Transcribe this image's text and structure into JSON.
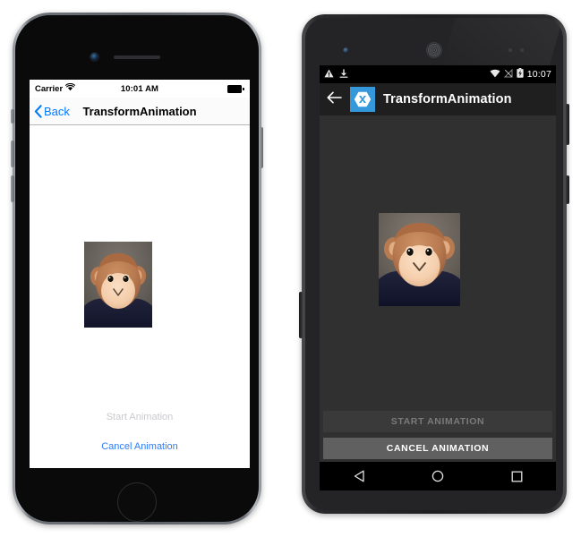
{
  "scene": {
    "description": "Side-by-side iOS and Android simulator screenshots of a TransformAnimation sample app",
    "devices": [
      "iphone",
      "android"
    ]
  },
  "ios": {
    "device_name": "iPhone",
    "status_bar": {
      "carrier": "Carrier",
      "wifi_icon": "wifi-icon",
      "time": "10:01 AM",
      "battery_icon": "battery-full-icon"
    },
    "nav_bar": {
      "back_icon": "chevron-left-icon",
      "back_label": "Back",
      "title": "TransformAnimation"
    },
    "content": {
      "image_name": "monkey-photo"
    },
    "actions": [
      {
        "label": "Start Animation",
        "state": "disabled",
        "color": "#c9c9ce"
      },
      {
        "label": "Cancel Animation",
        "state": "enabled",
        "color": "#2f7bf6"
      }
    ],
    "hardware": {
      "camera": "front-camera",
      "speaker": "earpiece-speaker",
      "home_button": "home-button"
    }
  },
  "android": {
    "device_name": "Android phone",
    "status_bar": {
      "left_icons": [
        "warning-triangle-icon",
        "download-icon"
      ],
      "right_icons": [
        "wifi-icon",
        "no-signal-icon",
        "battery-charging-icon"
      ],
      "time": "10:07"
    },
    "app_bar": {
      "back_icon": "arrow-left-icon",
      "logo_icon": "xamarin-logo-icon",
      "logo_color": "#3498db",
      "title": "TransformAnimation"
    },
    "content": {
      "image_name": "monkey-photo"
    },
    "buttons": [
      {
        "label": "START ANIMATION",
        "state": "disabled",
        "bg": "#3a3a3a",
        "color": "#7a7a7a"
      },
      {
        "label": "CANCEL ANIMATION",
        "state": "enabled",
        "bg": "#606060",
        "color": "#ffffff"
      }
    ],
    "nav_bar": {
      "back_icon": "nav-back-triangle-icon",
      "home_icon": "nav-home-circle-icon",
      "recents_icon": "nav-recents-square-icon"
    },
    "hardware": {
      "camera": "front-camera",
      "speaker": "earpiece-speaker",
      "sensors": "proximity-sensors"
    }
  },
  "theme": {
    "ios_accent": "#007aff",
    "ios_background": "#ffffff",
    "android_background": "#303030",
    "android_appbar": "#1f1f1f",
    "android_statusbar": "#000000",
    "xamarin_blue": "#3498db"
  }
}
